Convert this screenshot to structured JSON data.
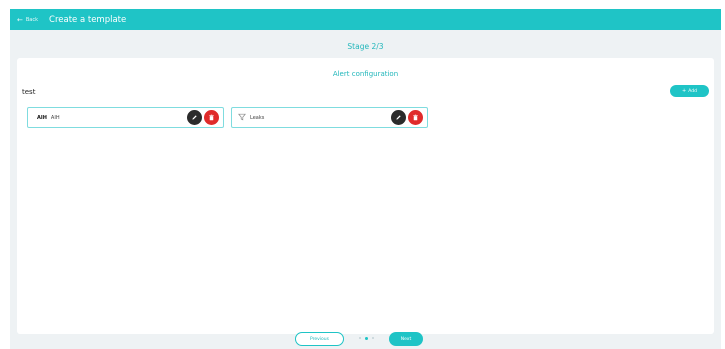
{
  "header": {
    "back_label": "Back",
    "title": "Create a template"
  },
  "stage": {
    "label": "Stage 2/3"
  },
  "panel": {
    "title": "Alert configuration",
    "section_label": "test",
    "add_label": "Add"
  },
  "cards": [
    {
      "icon_text": "AIH",
      "label": "AIH",
      "icon": "aih-text-icon"
    },
    {
      "icon_text": "",
      "label": "Leaks",
      "icon": "funnel-icon"
    }
  ],
  "footer": {
    "previous_label": "Previous",
    "next_label": "Next",
    "step_count": 3,
    "active_step": 2
  },
  "colors": {
    "accent": "#1fc4c6",
    "edit": "#2b2b2b",
    "delete": "#e02b2b",
    "background": "#eef2f4"
  }
}
